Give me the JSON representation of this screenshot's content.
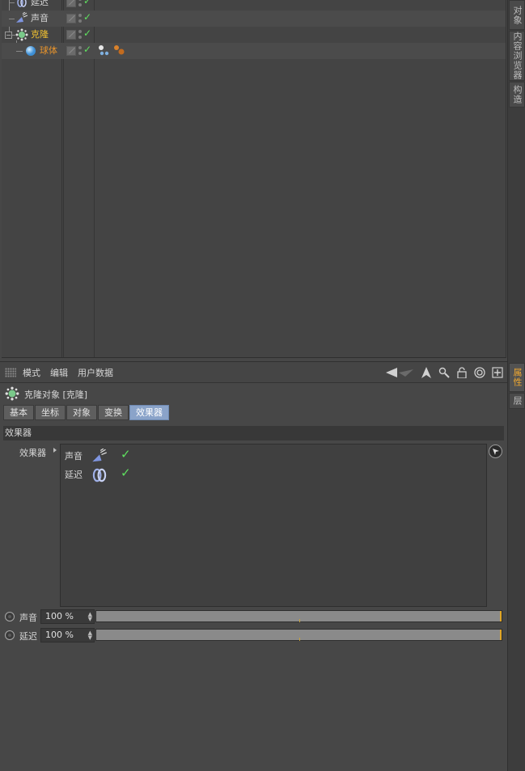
{
  "object_manager": {
    "rows": [
      {
        "label": "延迟",
        "icon": "delay-effector-icon",
        "depth": 1,
        "color": "#d7d7d7"
      },
      {
        "label": "声音",
        "icon": "sound-effector-icon",
        "depth": 1,
        "color": "#d7d7d7"
      },
      {
        "label": "克隆",
        "icon": "cloner-icon",
        "depth": 0,
        "color": "#f0c030",
        "expand": "−"
      },
      {
        "label": "球体",
        "icon": "sphere-icon",
        "depth": 1,
        "color": "#e8942c"
      }
    ]
  },
  "right_tabs": {
    "top": [
      "对象",
      "内容浏览器",
      "构造"
    ],
    "bottom": [
      "属性",
      "层"
    ]
  },
  "attribute_manager": {
    "menu": [
      "模式",
      "编辑",
      "用户数据"
    ],
    "object_title": "克隆对象 [克隆]",
    "tabs": [
      "基本",
      "坐标",
      "对象",
      "变换",
      "效果器"
    ],
    "active_tab": "效果器",
    "section": "效果器",
    "field_label": "效果器",
    "effectors": [
      {
        "name": "声音",
        "icon": "sound-effector-icon",
        "enabled": "✓"
      },
      {
        "name": "延迟",
        "icon": "delay-effector-icon",
        "enabled": "✓"
      }
    ],
    "strengths": [
      {
        "name": "声音",
        "value": "100 %",
        "fraction": 1.0
      },
      {
        "name": "延迟",
        "value": "100 %",
        "fraction": 1.0
      }
    ]
  },
  "colors": {
    "accent_tab": "#8aa3c9",
    "check_green": "#5fe05f",
    "active_vtab": "#f0a830"
  }
}
